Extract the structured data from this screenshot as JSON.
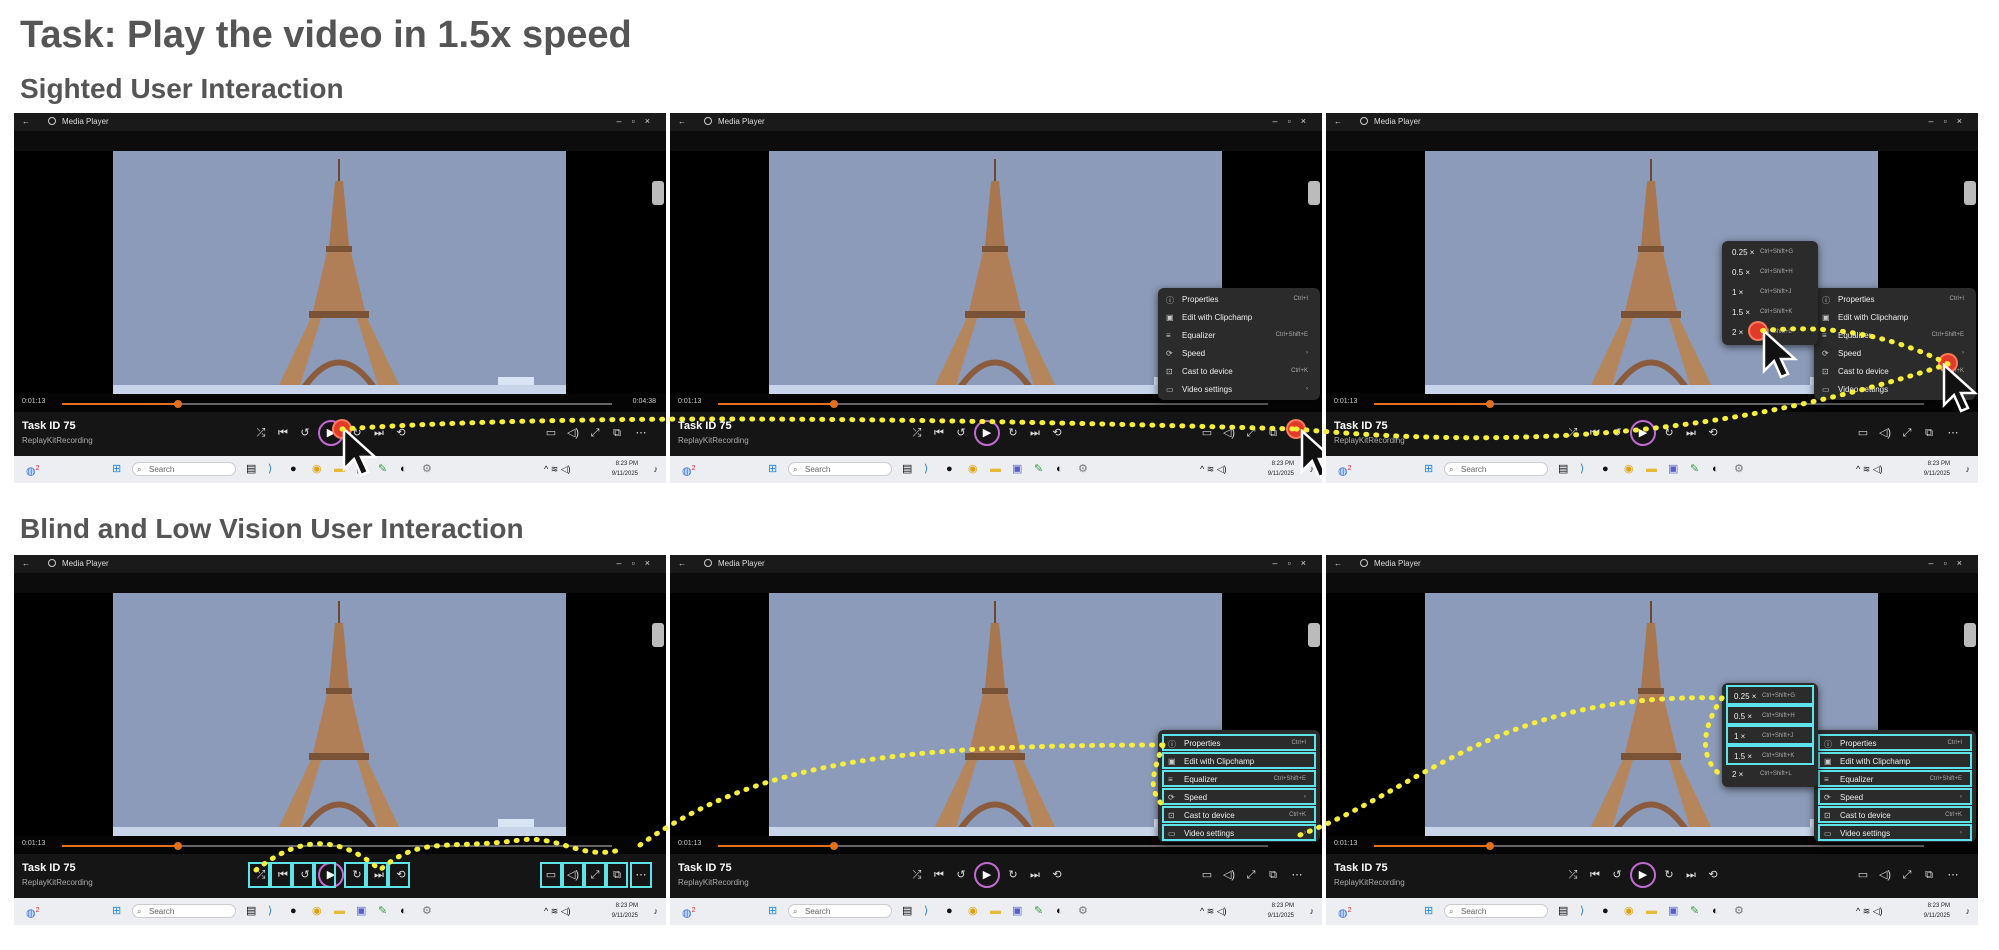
{
  "heading": {
    "task": "Task: Play the video in 1.5x speed",
    "sighted": "Sighted User Interaction",
    "blv": "Blind and Low Vision User Interaction"
  },
  "player": {
    "app_title": "Media Player",
    "task_id": "Task ID 75",
    "subtitle": "ReplayKitRecording",
    "time_elapsed": "0:01:13",
    "time_total": "0:04:38",
    "progress_fraction": 0.21
  },
  "taskbar": {
    "search_placeholder": "Search",
    "time": "8:23 PM",
    "date": "9/11/2025",
    "badge": "2"
  },
  "context_menu": [
    {
      "icon": "info-icon",
      "label": "Properties",
      "shortcut": "Ctrl+I"
    },
    {
      "icon": "clipchamp-icon",
      "label": "Edit with Clipchamp",
      "shortcut": ""
    },
    {
      "icon": "equalizer-icon",
      "label": "Equalizer",
      "shortcut": "Ctrl+Shift+E"
    },
    {
      "icon": "speed-icon",
      "label": "Speed",
      "shortcut": "›"
    },
    {
      "icon": "cast-icon",
      "label": "Cast to device",
      "shortcut": "Ctrl+K"
    },
    {
      "icon": "video-settings-icon",
      "label": "Video settings",
      "shortcut": "›"
    }
  ],
  "speed_menu": [
    {
      "label": "0.25 ×",
      "shortcut": "Ctrl+Shift+G"
    },
    {
      "label": "0.5 ×",
      "shortcut": "Ctrl+Shift+H"
    },
    {
      "label": "1 ×",
      "shortcut": "Ctrl+Shift+J"
    },
    {
      "label": "1.5 ×",
      "shortcut": "Ctrl+Shift+K"
    },
    {
      "label": "2 ×",
      "shortcut": "Ctrl+Shift+L"
    }
  ],
  "colors": {
    "highlight": "#5fe3ea",
    "path": "#f5ee3a",
    "click_marker": "#e13a28",
    "progress": "#e2701e"
  }
}
